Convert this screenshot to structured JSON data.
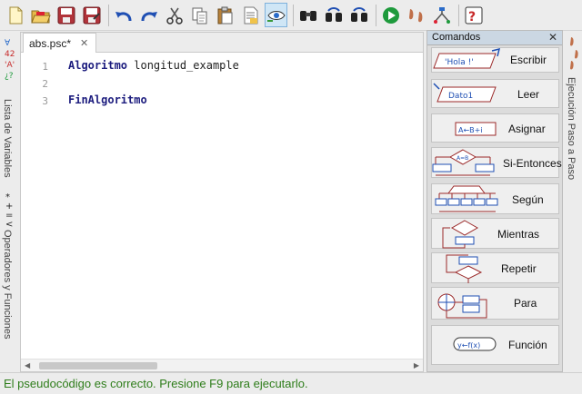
{
  "toolbar": {
    "buttons": [
      {
        "name": "new-file-icon"
      },
      {
        "name": "open-folder-icon"
      },
      {
        "name": "save-icon"
      },
      {
        "name": "save-as-icon"
      },
      {
        "name": "undo-icon"
      },
      {
        "name": "redo-icon"
      },
      {
        "name": "cut-icon"
      },
      {
        "name": "copy-icon"
      },
      {
        "name": "paste-icon"
      },
      {
        "name": "comment-icon"
      },
      {
        "name": "indent-icon"
      },
      {
        "name": "search-icon"
      },
      {
        "name": "search-next-icon"
      },
      {
        "name": "replace-icon"
      },
      {
        "name": "run-icon"
      },
      {
        "name": "step-by-step-icon"
      },
      {
        "name": "diagram-icon"
      },
      {
        "name": "help-icon"
      }
    ]
  },
  "left_panel": {
    "variables_label": "Lista de Variables",
    "operators_label": "Operadores y Funciones",
    "variables_icons": "*+=<",
    "operators_icons": "*+=<"
  },
  "editor": {
    "tab_title": "abs.psc*",
    "tab_close": "✕",
    "lines": [
      {
        "number": "1",
        "keyword": "Algoritmo",
        "rest": " longitud_example"
      },
      {
        "number": "2",
        "keyword": "",
        "rest": ""
      },
      {
        "number": "3",
        "keyword": "FinAlgoritmo",
        "rest": ""
      }
    ]
  },
  "commands": {
    "title": "Comandos",
    "close": "✕",
    "items": [
      {
        "label": "Escribir",
        "shape_text": "'Hola !'"
      },
      {
        "label": "Leer",
        "shape_text": "Dato1"
      },
      {
        "label": "Asignar",
        "shape_text": "A←B+i"
      },
      {
        "label": "Si-Entonces",
        "shape_text": "A=B"
      },
      {
        "label": "Según",
        "shape_text": ""
      },
      {
        "label": "Mientras",
        "shape_text": ""
      },
      {
        "label": "Repetir",
        "shape_text": ""
      },
      {
        "label": "Para",
        "shape_text": ""
      },
      {
        "label": "Función",
        "shape_text": "y←f(x)"
      }
    ]
  },
  "right_panel": {
    "label": "Ejecución Paso a Paso"
  },
  "status": {
    "message": "El pseudocódigo es correcto. Presione F9 para ejecutarlo."
  },
  "colors": {
    "status_text": "#2e7d1a",
    "keyword": "#1c1c7e",
    "accent_blue": "#1f4fb3",
    "accent_red": "#9b2a2a"
  }
}
